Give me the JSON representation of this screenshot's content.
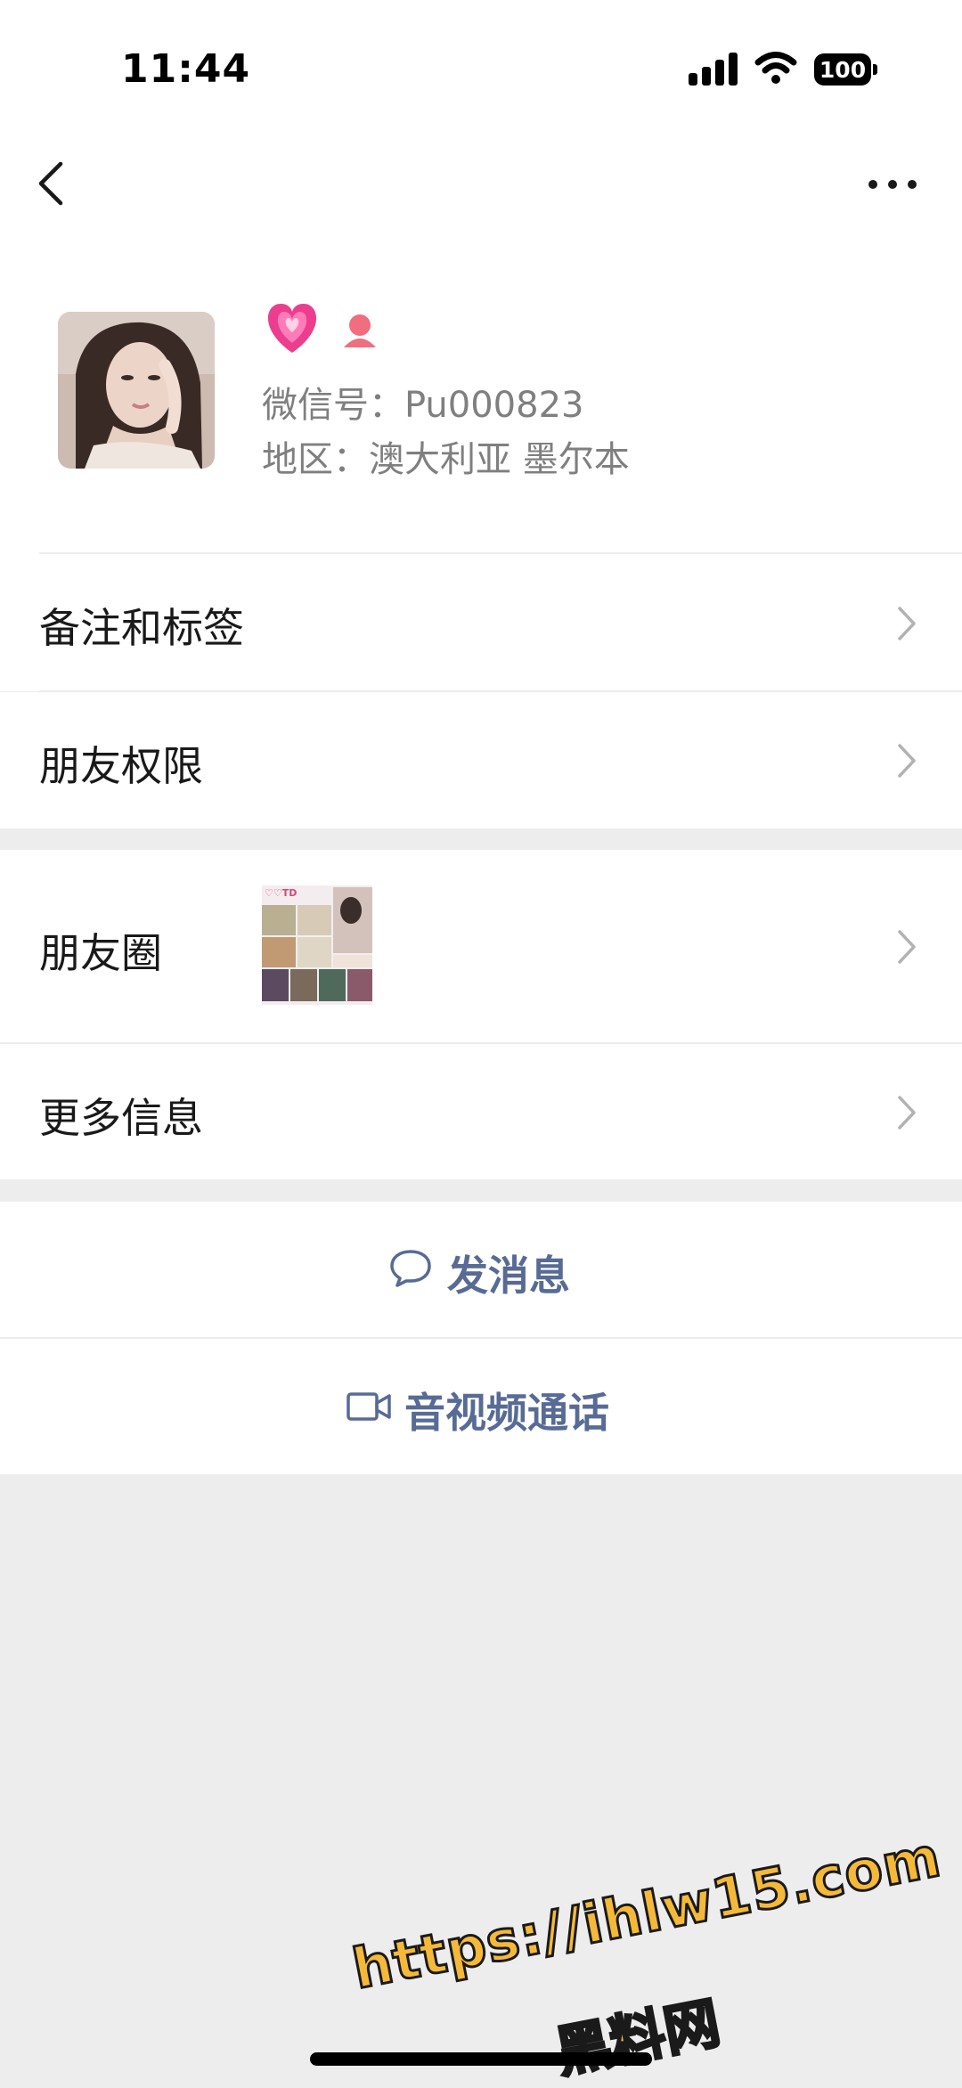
{
  "status_bar": {
    "time": "11:44",
    "battery": "100"
  },
  "profile": {
    "wechat_id": "微信号：Pu000823",
    "region": "地区：澳大利亚 墨尔本"
  },
  "rows": {
    "remarks_tags": "备注和标签",
    "friend_permissions": "朋友权限",
    "moments": "朋友圈",
    "more_info": "更多信息"
  },
  "moments_thumb": {
    "caption": "♡♡TD"
  },
  "actions": {
    "send_message": "发消息",
    "av_call": "音视频通话"
  },
  "watermark": {
    "url": "https://ihlw15.com",
    "name": "黑料网"
  },
  "colors": {
    "background": "#ededed",
    "surface": "#ffffff",
    "action_blue": "#576b95",
    "secondary_text": "#7f7f7f",
    "heart": "#ec3d8e",
    "gender_female": "#f06e7e"
  }
}
